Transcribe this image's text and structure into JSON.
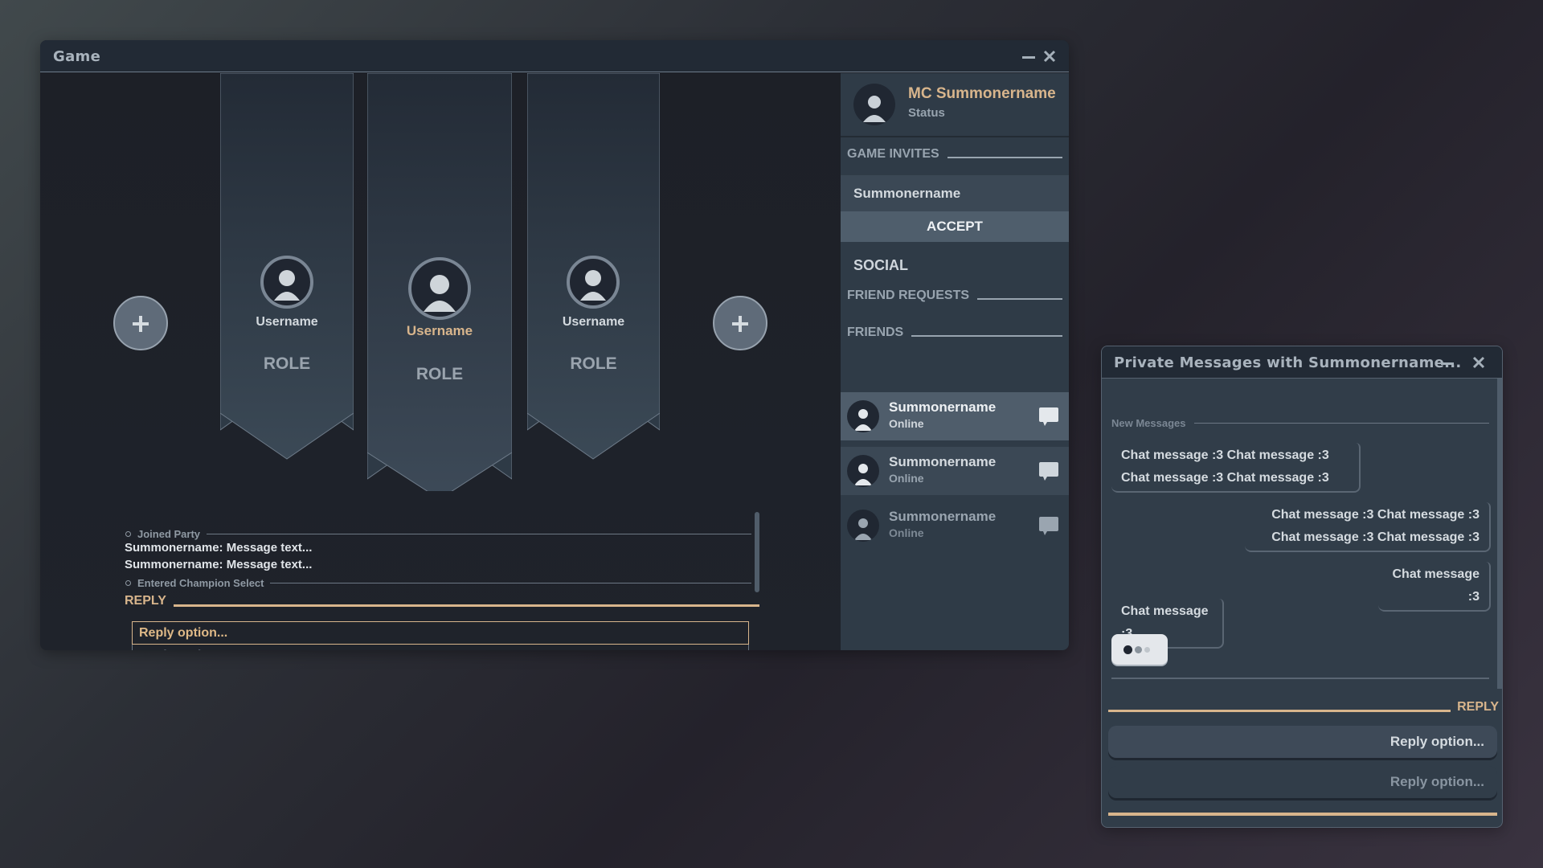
{
  "game_window": {
    "title": "Game",
    "controls": {
      "minimize": "minimize-icon",
      "close": "close-icon"
    },
    "lobby": {
      "invite_slots": [
        {
          "icon": "plus-icon",
          "label": "add-player"
        },
        {
          "icon": "plus-icon",
          "label": "add-player"
        }
      ],
      "members": [
        {
          "username": "Username",
          "role": "ROLE",
          "is_self": false
        },
        {
          "username": "Username",
          "role": "ROLE",
          "is_self": true
        },
        {
          "username": "Username",
          "role": "ROLE",
          "is_self": false
        }
      ]
    },
    "chat": {
      "lines": [
        {
          "type": "system",
          "text": "Joined Party"
        },
        {
          "type": "message",
          "text": "Summonername: Message text..."
        },
        {
          "type": "message",
          "text": "Summonername: Message text..."
        },
        {
          "type": "system",
          "text": "Entered Champion Select"
        }
      ],
      "reply_label": "REPLY",
      "reply_options": [
        {
          "text": "Reply option...",
          "selected": true
        },
        {
          "text": "Reply option...",
          "selected": false
        }
      ]
    },
    "sidebar": {
      "profile": {
        "name": "MC Summonername",
        "status": "Status"
      },
      "game_invites_label": "GAME INVITES",
      "invite": {
        "from": "Summonername",
        "accept_label": "ACCEPT"
      },
      "social_label": "SOCIAL",
      "friend_requests_label": "FRIEND REQUESTS",
      "friends_label": "FRIENDS",
      "friends": [
        {
          "name": "Summonername",
          "status": "Online",
          "state": "hover"
        },
        {
          "name": "Summonername",
          "status": "Online",
          "state": "normal"
        },
        {
          "name": "Summonername",
          "status": "Online",
          "state": "dim"
        }
      ]
    }
  },
  "pm_window": {
    "title": "Private Messages with Summonername...",
    "new_messages_label": "New Messages",
    "messages": [
      {
        "direction": "in",
        "text": "Chat message :3 Chat message :3 Chat message :3 Chat message :3"
      },
      {
        "direction": "out",
        "text": "Chat message :3 Chat message :3 Chat message :3 Chat message :3"
      },
      {
        "direction": "out",
        "text": "Chat message :3"
      },
      {
        "direction": "in",
        "text": "Chat message :3"
      }
    ],
    "typing_indicator": "typing-dots-icon",
    "reply_label": "REPLY",
    "reply_options": [
      {
        "text": "Reply option...",
        "selected": true
      },
      {
        "text": "Reply option...",
        "selected": false
      }
    ]
  },
  "colors": {
    "accent": "#d8b58c",
    "window_header": "#222a35",
    "sidebar_bg": "#2f3b47",
    "stage_bg": "#1e222a"
  }
}
